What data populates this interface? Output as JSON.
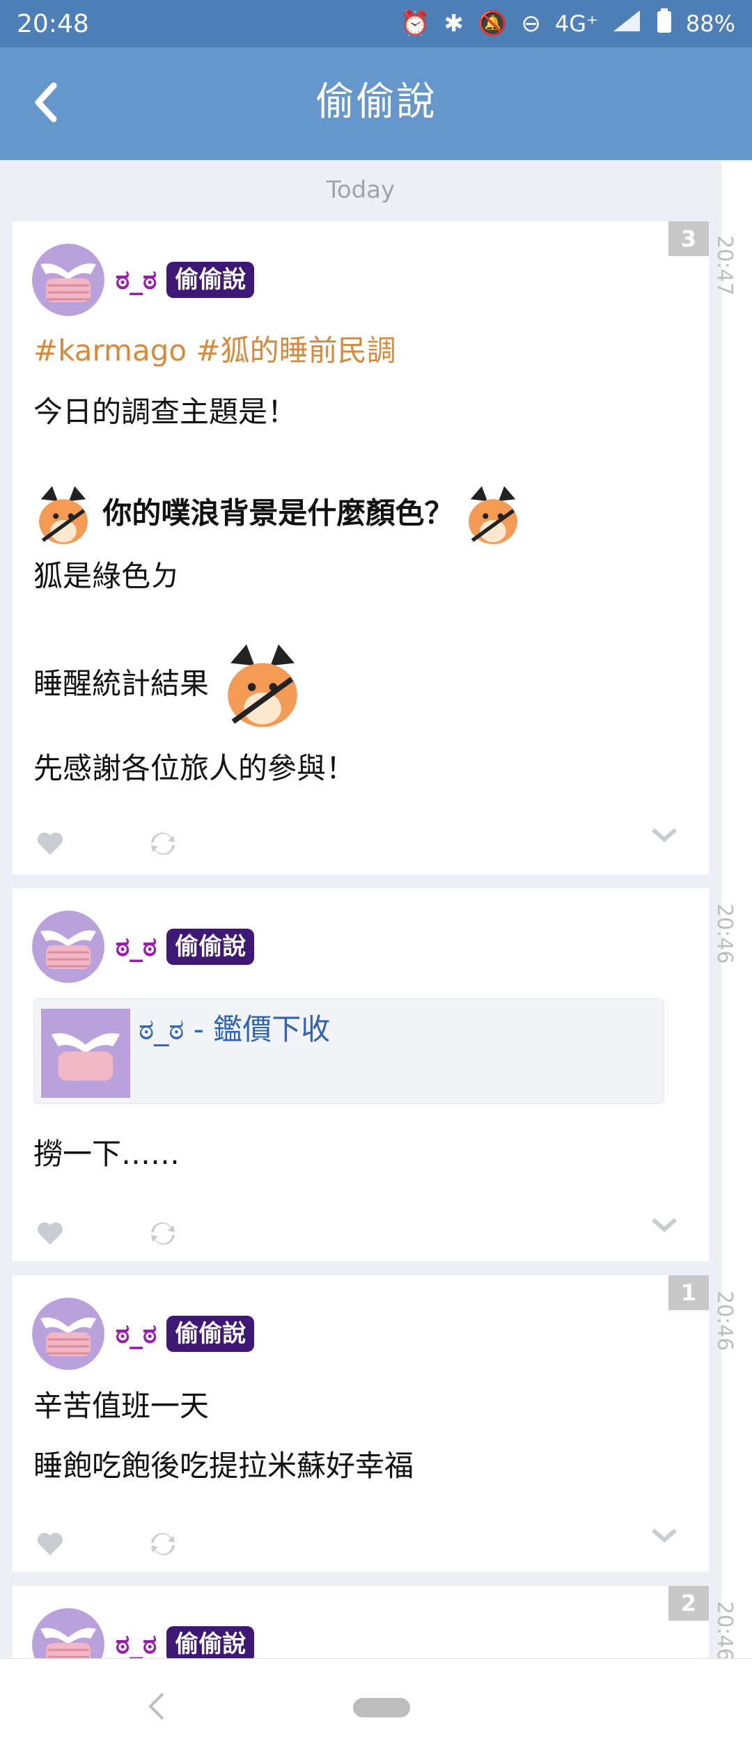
{
  "status_bar": {
    "time": "20:48",
    "network": "4G⁺",
    "battery": "88%",
    "icons": [
      "alarm-icon",
      "bluetooth-icon",
      "notifications-off-icon",
      "do-not-disturb-icon",
      "signal-icon",
      "battery-icon"
    ]
  },
  "app_bar": {
    "title": "偷偷說",
    "back_icon": "back-arrow-icon"
  },
  "feed": {
    "date_divider": "Today",
    "posts": [
      {
        "time": "20:47",
        "count": "3",
        "username": "ಠ_ಠ",
        "tag": "偷偷說",
        "lines": {
          "hashtags": "#karmago #狐的睡前民調",
          "l1": "今日的調查主題是！",
          "l2": "你的噗浪背景是什麼顏色？",
          "l3": "狐是綠色ㄉ",
          "l4": "睡醒統計結果",
          "l5": "先感謝各位旅人的參與！"
        }
      },
      {
        "time": "20:46",
        "username": "ಠ_ಠ",
        "tag": "偷偷說",
        "link_title": "ಠ_ಠ - 鑑價下收",
        "lines": {
          "l1": "撈一下……"
        }
      },
      {
        "time": "20:46",
        "count": "1",
        "username": "ಠ_ಠ",
        "tag": "偷偷說",
        "lines": {
          "l1": "辛苦值班一天",
          "l2": "睡飽吃飽後吃提拉米蘇好幸福"
        }
      },
      {
        "time": "20:46",
        "count": "2",
        "username": "ಠ_ಠ",
        "tag": "偷偷說"
      }
    ]
  },
  "colors": {
    "status_bar": "#4e7fb7",
    "app_bar": "#6597cc",
    "username": "#9c1ab1",
    "tag_bg": "#3d1874",
    "hashtag": "#d68a3a",
    "link": "#2f63b3"
  }
}
